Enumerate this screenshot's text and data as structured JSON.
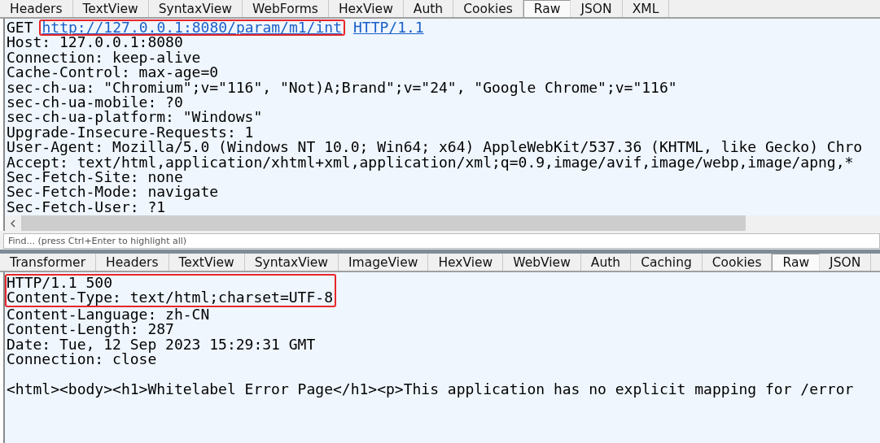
{
  "request_tabs": [
    {
      "label": "Headers",
      "selected": false
    },
    {
      "label": "TextView",
      "selected": false
    },
    {
      "label": "SyntaxView",
      "selected": false
    },
    {
      "label": "WebForms",
      "selected": false
    },
    {
      "label": "HexView",
      "selected": false
    },
    {
      "label": "Auth",
      "selected": false
    },
    {
      "label": "Cookies",
      "selected": false
    },
    {
      "label": "Raw",
      "selected": true
    },
    {
      "label": "JSON",
      "selected": false
    },
    {
      "label": "XML",
      "selected": false
    }
  ],
  "request": {
    "request_line": {
      "method": "GET",
      "url": "http://127.0.0.1:8080/param/m1/int",
      "url_highlighted": true,
      "version": "HTTP/1.1"
    },
    "lines": [
      "Host: 127.0.0.1:8080",
      "Connection: keep-alive",
      "Cache-Control: max-age=0",
      "sec-ch-ua: \"Chromium\";v=\"116\", \"Not)A;Brand\";v=\"24\", \"Google Chrome\";v=\"116\"",
      "sec-ch-ua-mobile: ?0",
      "sec-ch-ua-platform: \"Windows\"",
      "Upgrade-Insecure-Requests: 1",
      "User-Agent: Mozilla/5.0 (Windows NT 10.0; Win64; x64) AppleWebKit/537.36 (KHTML, like Gecko) Chro",
      "Accept: text/html,application/xhtml+xml,application/xml;q=0.9,image/avif,image/webp,image/apng,*",
      "Sec-Fetch-Site: none",
      "Sec-Fetch-Mode: navigate",
      "Sec-Fetch-User: ?1"
    ]
  },
  "find": {
    "placeholder": "Find... (press Ctrl+Enter to highlight all)"
  },
  "response_tabs": [
    {
      "label": "Transformer",
      "selected": false
    },
    {
      "label": "Headers",
      "selected": false
    },
    {
      "label": "TextView",
      "selected": false
    },
    {
      "label": "SyntaxView",
      "selected": false
    },
    {
      "label": "ImageView",
      "selected": false
    },
    {
      "label": "HexView",
      "selected": false
    },
    {
      "label": "WebView",
      "selected": false
    },
    {
      "label": "Auth",
      "selected": false
    },
    {
      "label": "Caching",
      "selected": false
    },
    {
      "label": "Cookies",
      "selected": false
    },
    {
      "label": "Raw",
      "selected": true
    },
    {
      "label": "JSON",
      "selected": false
    }
  ],
  "response": {
    "lines": [
      {
        "text": "HTTP/1.1 500",
        "highlighted": true
      },
      {
        "text": "Content-Type: text/html;charset=UTF-8",
        "highlighted": true
      },
      {
        "text": "Content-Language: zh-CN",
        "highlighted": false
      },
      {
        "text": "Content-Length: 287",
        "highlighted": false
      },
      {
        "text": "Date: Tue, 12 Sep 2023 15:29:31 GMT",
        "highlighted": false
      },
      {
        "text": "Connection: close",
        "highlighted": false
      },
      {
        "kind": "blank"
      },
      {
        "text": "<html><body><h1>Whitelabel Error Page</h1><p>This application has no explicit mapping for /error",
        "highlighted": false
      }
    ]
  }
}
